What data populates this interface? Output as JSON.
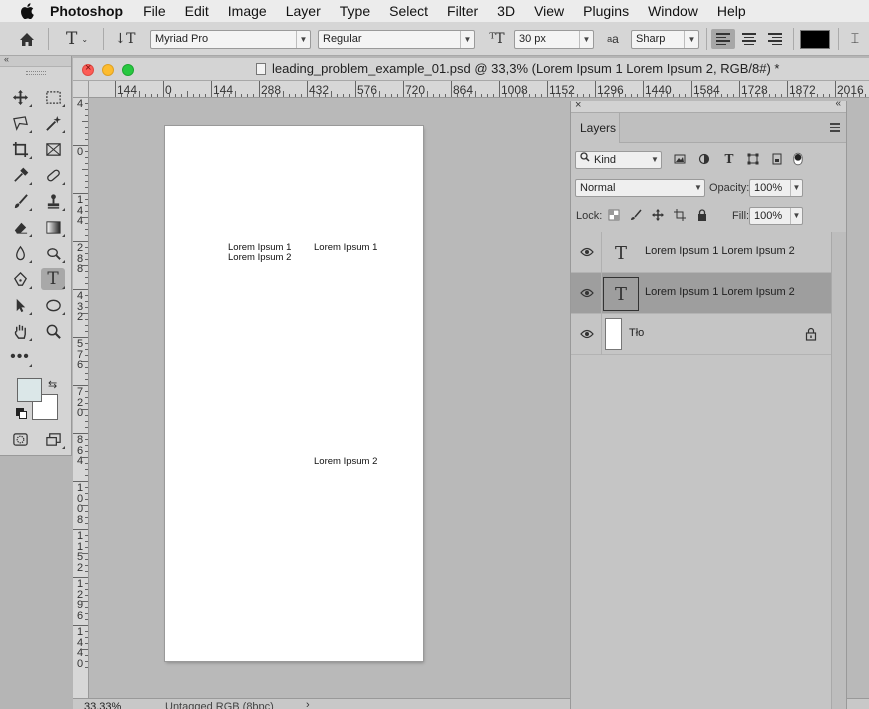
{
  "menubar": {
    "app_name": "Photoshop",
    "items": [
      "File",
      "Edit",
      "Image",
      "Layer",
      "Type",
      "Select",
      "Filter",
      "3D",
      "View",
      "Plugins",
      "Window",
      "Help"
    ]
  },
  "options_bar": {
    "font_family": "Myriad Pro",
    "font_style": "Regular",
    "font_size": "30 px",
    "aa_label": "a",
    "antialias": "Sharp",
    "text_color": "#000000"
  },
  "tools": {
    "foreground_color": "#dbe7e8",
    "background_color": "#ffffff"
  },
  "document": {
    "title": "leading_problem_example_01.psd @ 33,3% (Lorem Ipsum 1 Lorem Ipsum 2, RGB/8#) *",
    "h_ruler_labels": [
      "144",
      "0",
      "144",
      "288",
      "432",
      "576",
      "720",
      "864",
      "1008",
      "1152",
      "1296",
      "1440",
      "1584",
      "1728",
      "1872",
      "2016"
    ],
    "v_ruler_labels": [
      "4",
      "0",
      "1\n4\n4",
      "2\n8\n8",
      "4\n3\n2",
      "5\n7\n6",
      "7\n2\n0",
      "8\n6\n4",
      "1\n0\n0\n8",
      "1\n1\n5\n2",
      "1\n2\n9\n6",
      "1\n4\n4\n0"
    ],
    "canvas_texts": {
      "left_line1": "Lorem Ipsum 1",
      "left_line2": "Lorem Ipsum 2",
      "right_top": "Lorem Ipsum 1",
      "right_bottom": "Lorem Ipsum 2"
    },
    "status": {
      "zoom": "33,33%",
      "profile": "Untagged RGB (8bpc)",
      "arrow": "›"
    }
  },
  "layers_panel": {
    "tab_label": "Layers",
    "filter_kind": "Kind",
    "blend_mode": "Normal",
    "opacity_label": "Opacity:",
    "opacity_value": "100%",
    "lock_label": "Lock:",
    "fill_label": "Fill:",
    "fill_value": "100%",
    "layers": [
      {
        "name": "Lorem Ipsum 1 Lorem Ipsum 2",
        "type": "text",
        "selected": false,
        "thumb": "T"
      },
      {
        "name": "Lorem Ipsum 1 Lorem Ipsum 2",
        "type": "text",
        "selected": true,
        "thumb": "T"
      },
      {
        "name": "Tło",
        "type": "background",
        "selected": false,
        "locked": true
      }
    ]
  }
}
